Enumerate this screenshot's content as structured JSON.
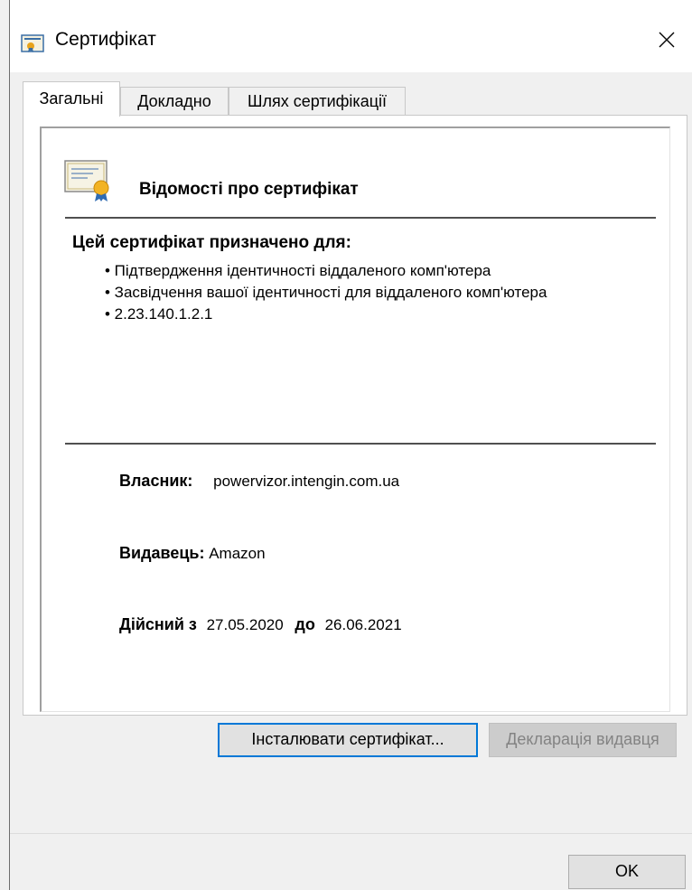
{
  "window": {
    "title": "Сертифікат",
    "title_icon": "certificate-icon",
    "close_icon": "close-icon"
  },
  "tabs": [
    {
      "label": "Загальні",
      "active": true
    },
    {
      "label": "Докладно",
      "active": false
    },
    {
      "label": "Шлях сертифікації",
      "active": false
    }
  ],
  "general": {
    "info_title": "Відомості про сертифікат",
    "info_icon": "certificate-icon",
    "purpose_heading": "Цей сертифікат призначено для:",
    "purposes": [
      "• Підтвердження ідентичності віддаленого комп'ютера",
      "• Засвідчення вашої ідентичності для віддаленого комп'ютера",
      "• 2.23.140.1.2.1"
    ],
    "owner_label": "Власник:",
    "owner_value": "powervizor.intengin.com.ua",
    "issuer_label": "Видавець:",
    "issuer_value": "Amazon",
    "valid_from_label": "Дійсний з",
    "valid_from_value": "27.05.2020",
    "valid_to_label": "до",
    "valid_to_value": "26.06.2021"
  },
  "buttons": {
    "install": "Інсталювати сертифікат...",
    "issuer_statement": "Декларація видавця",
    "ok": "OK"
  }
}
